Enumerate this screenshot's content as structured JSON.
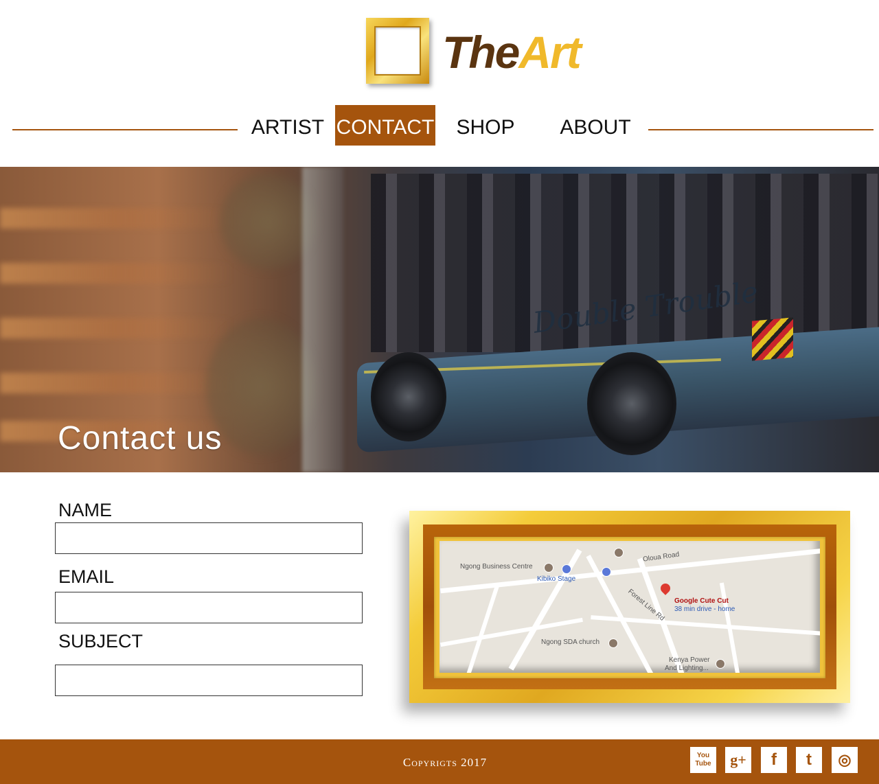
{
  "brand": {
    "name_part1": "The",
    "name_part2": "Art"
  },
  "nav": {
    "items": [
      {
        "label": "ARTIST"
      },
      {
        "label": "CONTACT"
      },
      {
        "label": "SHOP"
      },
      {
        "label": "ABOUT"
      }
    ],
    "active": "CONTACT"
  },
  "hero": {
    "title": "Contact us",
    "bus_script": "Double Trouble"
  },
  "form": {
    "name_label": "NAME",
    "email_label": "EMAIL",
    "subject_label": "SUBJECT"
  },
  "map": {
    "labels": {
      "business_centre": "Ngong Business Centre",
      "kibiko": "Kibiko Stage",
      "oloua": "Oloua Road",
      "forest": "Forest Line Rd",
      "google": "Google Cute Cut",
      "drive": "38 min drive - home",
      "sda": "Ngong SDA church",
      "kenya1": "Kenya Power",
      "kenya2": "And Lighting..."
    }
  },
  "footer": {
    "copyright": "Copyrigts 2017",
    "social": [
      {
        "icon": "youtube-icon",
        "glyph": "You Tube"
      },
      {
        "icon": "google-plus-icon",
        "glyph": "g+"
      },
      {
        "icon": "facebook-icon",
        "glyph": "f"
      },
      {
        "icon": "twitter-icon",
        "glyph": "t"
      },
      {
        "icon": "instagram-icon",
        "glyph": "◎"
      }
    ]
  },
  "colors": {
    "brand_brown": "#a5540d",
    "gold": "#f0b92b",
    "dark_brown": "#5a3410"
  }
}
